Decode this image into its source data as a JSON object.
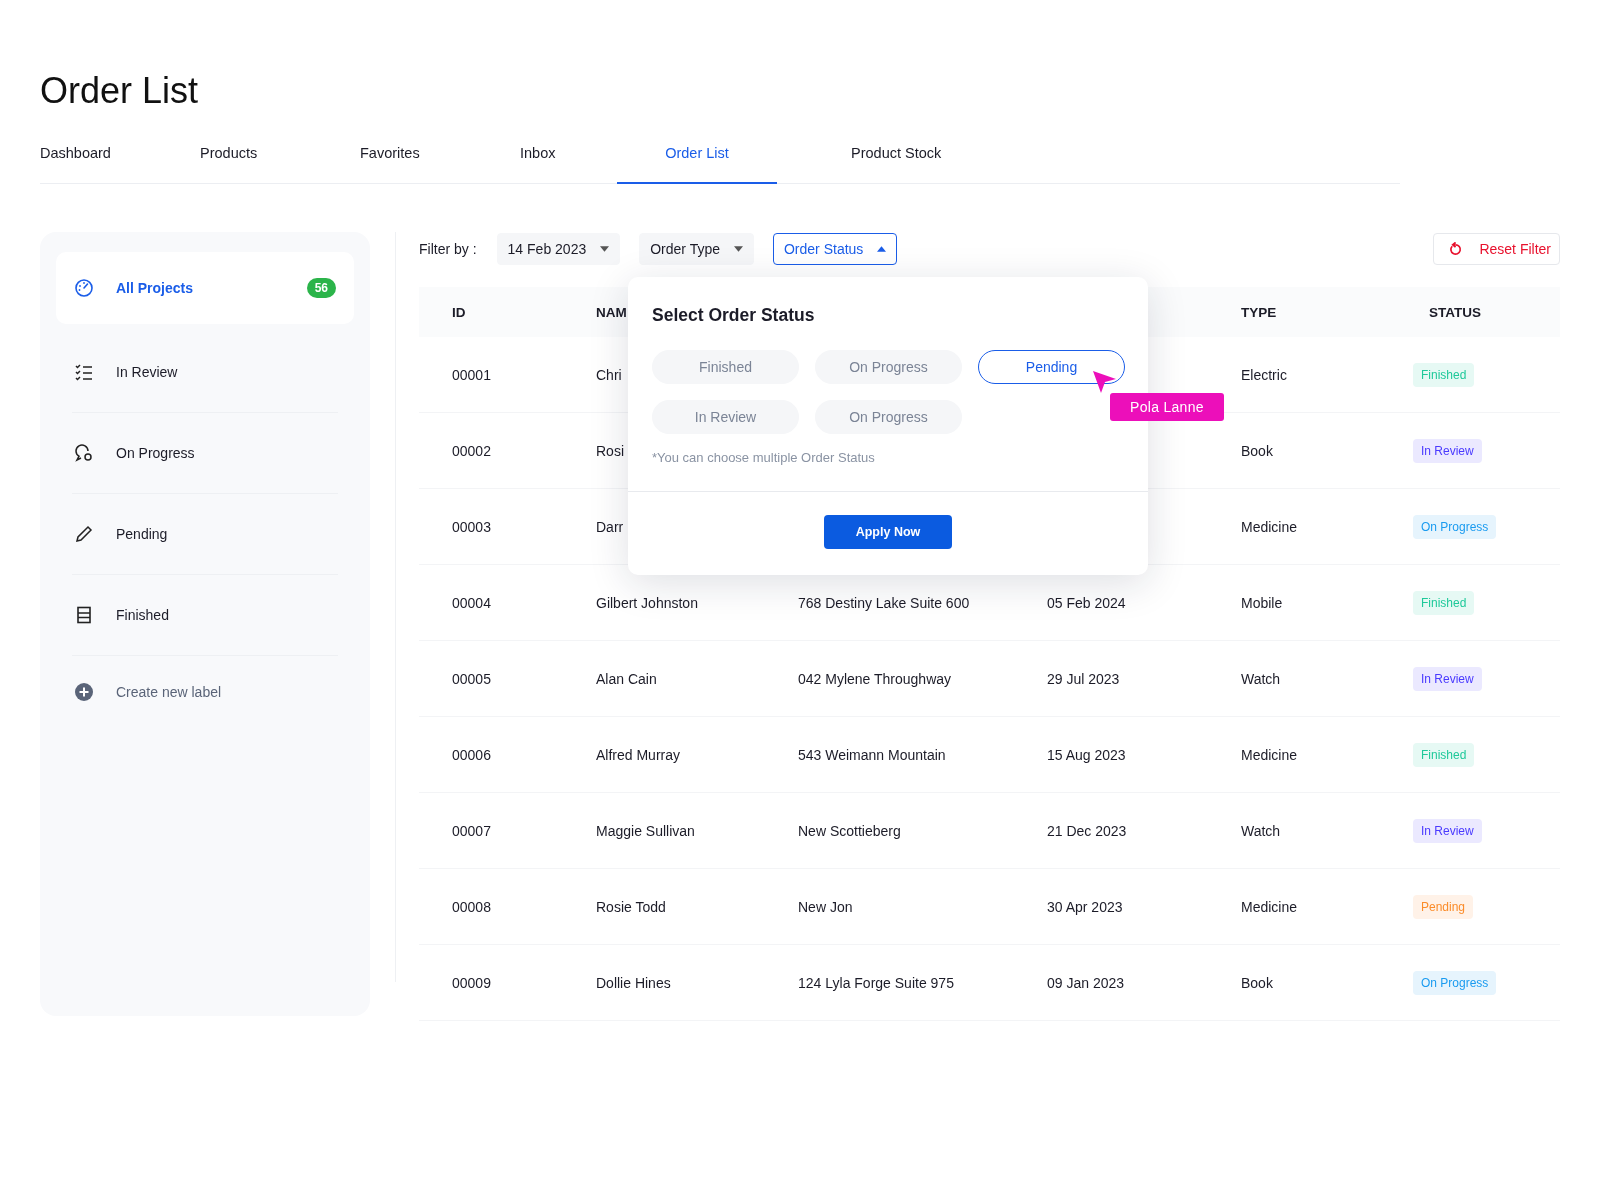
{
  "page_title": "Order List",
  "tabs": [
    {
      "label": "Dashboard",
      "selected": false
    },
    {
      "label": "Products",
      "selected": false
    },
    {
      "label": "Favorites",
      "selected": false
    },
    {
      "label": "Inbox",
      "selected": false
    },
    {
      "label": "Order List",
      "selected": true
    },
    {
      "label": "Product Stock",
      "selected": false
    }
  ],
  "sidebar": {
    "items": [
      {
        "label": "All Projects",
        "selected": true,
        "count": "56"
      },
      {
        "label": "In Review",
        "selected": false
      },
      {
        "label": "On Progress",
        "selected": false
      },
      {
        "label": "Pending",
        "selected": false
      },
      {
        "label": "Finished",
        "selected": false
      }
    ],
    "create_label": "Create new label"
  },
  "filter_bar": {
    "label": "Filter by :",
    "dropdowns": [
      {
        "value": "14 Feb 2023",
        "expanded": false
      },
      {
        "value": "Order Type",
        "expanded": false
      },
      {
        "value": "Order Status",
        "expanded": true
      }
    ],
    "reset_button": "Reset Filter"
  },
  "table": {
    "header": {
      "id": "ID",
      "name": "NAM",
      "type": "TYPE",
      "status": "STATUS"
    },
    "rows": [
      {
        "id": "00001",
        "name": "Chri",
        "type": "Electric",
        "status": {
          "label": "Finished",
          "color": "#1ec99a"
        }
      },
      {
        "id": "00002",
        "name": "Rosi",
        "type": "Book",
        "status": {
          "label": "In Review",
          "color": "#4a3aff"
        }
      },
      {
        "id": "00003",
        "name": "Darr",
        "type": "Medicine",
        "status": {
          "label": "On Progress",
          "color": "#1a9bf0"
        }
      },
      {
        "id": "00004",
        "name": "Gilbert Johnston",
        "column_3": "768 Destiny Lake Suite 600",
        "column_4": "05 Feb 2024",
        "type": "Mobile",
        "status": {
          "label": "Finished",
          "color": "#1ec99a"
        }
      },
      {
        "id": "00005",
        "name": "Alan Cain",
        "column_3": "042 Mylene Throughway",
        "column_4": "29 Jul 2023",
        "type": "Watch",
        "status": {
          "label": "In Review",
          "color": "#4a3aff"
        }
      },
      {
        "id": "00006",
        "name": "Alfred Murray",
        "column_3": "543 Weimann Mountain",
        "column_4": "15 Aug 2023",
        "type": "Medicine",
        "status": {
          "label": "Finished",
          "color": "#1ec99a"
        }
      },
      {
        "id": "00007",
        "name": "Maggie Sullivan",
        "column_3": "New Scottieberg",
        "column_4": "21 Dec 2023",
        "type": "Watch",
        "status": {
          "label": "In Review",
          "color": "#4a3aff"
        }
      },
      {
        "id": "00008",
        "name": "Rosie Todd",
        "column_3": "New Jon",
        "column_4": "30 Apr 2023",
        "type": "Medicine",
        "status": {
          "label": "Pending",
          "color": "#fb8c2a"
        }
      },
      {
        "id": "00009",
        "name": "Dollie Hines",
        "column_3": "124 Lyla Forge Suite 975",
        "column_4": "09 Jan 2023",
        "type": "Book",
        "status": {
          "label": "On Progress",
          "color": "#1a9bf0"
        }
      }
    ]
  },
  "status_popup": {
    "title": "Select Order Status",
    "options": [
      {
        "label": "Finished",
        "selected": false
      },
      {
        "label": "On Progress",
        "selected": false
      },
      {
        "label": "Pending",
        "selected": true
      },
      {
        "label": "In Review",
        "selected": false
      },
      {
        "label": "On Progress",
        "selected": false
      }
    ],
    "note": "*You can choose multiple Order Status",
    "apply_button": "Apply Now",
    "cursor_label": "Pola Lanne"
  }
}
